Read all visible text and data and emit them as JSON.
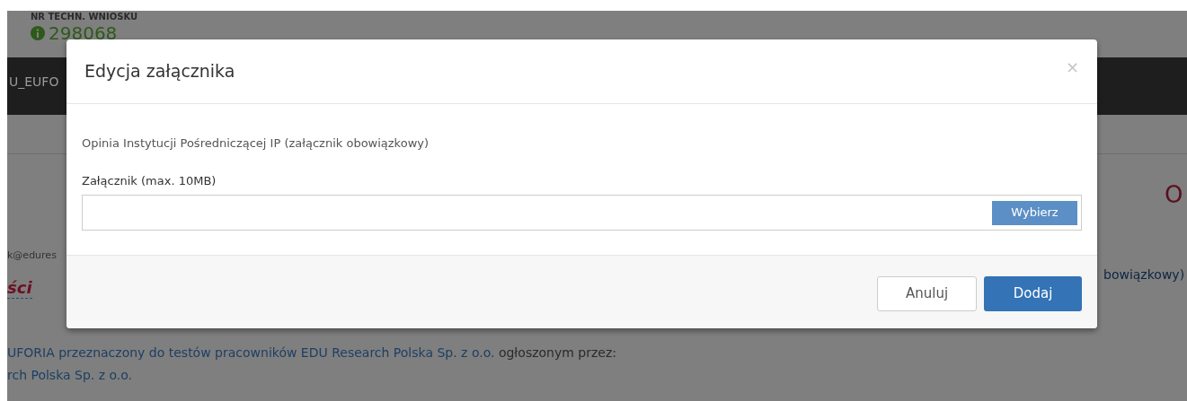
{
  "page": {
    "request_number_label": "NR TECHN. WNIOSKU",
    "request_number": "298068",
    "nav_text": "U_EUFO",
    "email": "k@edures",
    "section_title": "ści",
    "heading_fragment": "O",
    "right_link": "bowiązkowy)",
    "paragraph_lines": [
      [
        {
          "text": "UFORIA przeznaczony do testów pracowników EDU Research Polska Sp. z o.o.",
          "kind": "link"
        },
        {
          "text": " ogłoszonym przez:",
          "kind": "plain"
        }
      ],
      [
        {
          "text": "rch Polska Sp. z o.o.",
          "kind": "link"
        }
      ]
    ]
  },
  "modal": {
    "title": "Edycja załącznika",
    "close": "×",
    "description": "Opinia Instytucji Pośredniczącej IP (załącznik obowiązkowy)",
    "field_label": "Załącznik (max. 10MB)",
    "browse_button": "Wybierz",
    "buttons": [
      {
        "label": "Anuluj",
        "kind": "secondary"
      },
      {
        "label": "Dodaj",
        "kind": "primary"
      }
    ]
  }
}
